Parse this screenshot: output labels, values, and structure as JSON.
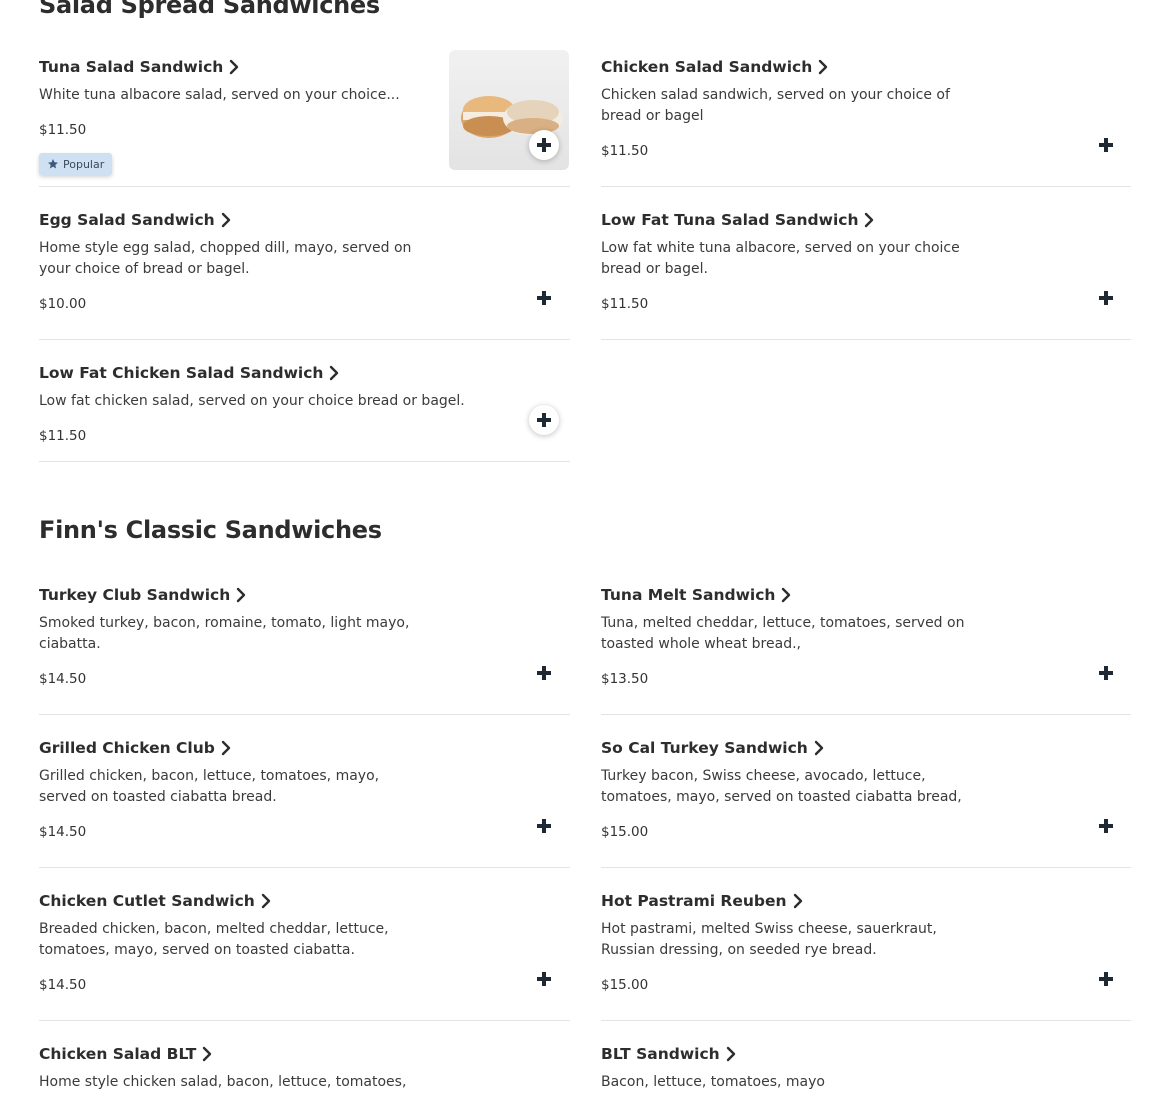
{
  "sections": [
    {
      "title": "Salad Spread Sandwiches",
      "items": [
        {
          "name": "Tuna Salad Sandwich",
          "description": "White tuna albacore salad, served on your choice...",
          "price": "$11.50",
          "badge": "Popular",
          "image": "bagel-sandwich-photo"
        },
        {
          "name": "Chicken Salad Sandwich",
          "description": "Chicken salad sandwich, served on your choice of bread or bagel",
          "price": "$11.50"
        },
        {
          "name": "Egg Salad Sandwich",
          "description": "Home style egg salad, chopped dill, mayo, served on your choice of bread or bagel.",
          "price": "$10.00"
        },
        {
          "name": "Low Fat Tuna Salad Sandwich",
          "description": "Low fat white tuna albacore, served on your choice bread or bagel.",
          "price": "$11.50"
        },
        {
          "name": "Low Fat Chicken Salad Sandwich",
          "description": "Low fat chicken salad, served on your choice bread or bagel.",
          "price": "$11.50"
        }
      ]
    },
    {
      "title": "Finn's Classic Sandwiches",
      "items": [
        {
          "name": "Turkey Club Sandwich",
          "description": "Smoked turkey, bacon, romaine, tomato, light mayo, ciabatta.",
          "price": "$14.50"
        },
        {
          "name": "Tuna Melt Sandwich",
          "description": "Tuna, melted cheddar, lettuce, tomatoes, served on toasted whole wheat bread.,",
          "price": "$13.50"
        },
        {
          "name": "Grilled Chicken Club",
          "description": "Grilled chicken, bacon, lettuce, tomatoes, mayo, served on toasted ciabatta bread.",
          "price": "$14.50"
        },
        {
          "name": "So Cal Turkey Sandwich",
          "description": "Turkey bacon, Swiss cheese, avocado, lettuce, tomatoes, mayo, served on toasted ciabatta bread,",
          "price": "$15.00"
        },
        {
          "name": "Chicken Cutlet Sandwich",
          "description": "Breaded chicken, bacon, melted cheddar, lettuce, tomatoes, mayo, served on toasted ciabatta.",
          "price": "$14.50"
        },
        {
          "name": "Hot Pastrami Reuben",
          "description": "Hot pastrami, melted Swiss cheese, sauerkraut, Russian dressing, on seeded rye bread.",
          "price": "$15.00"
        },
        {
          "name": "Chicken Salad BLT",
          "description": "Home style chicken salad, bacon, lettuce, tomatoes,",
          "price": ""
        },
        {
          "name": "BLT Sandwich",
          "description": "Bacon, lettuce, tomatoes, mayo",
          "price": ""
        }
      ]
    }
  ],
  "icons": {
    "add": "plus-icon",
    "chevron": "chevron-right-icon",
    "badge": "star-icon"
  },
  "colors": {
    "badge_bg": "#cfe0f2",
    "text": "#2d2d2d",
    "divider": "#e4e4e4"
  }
}
